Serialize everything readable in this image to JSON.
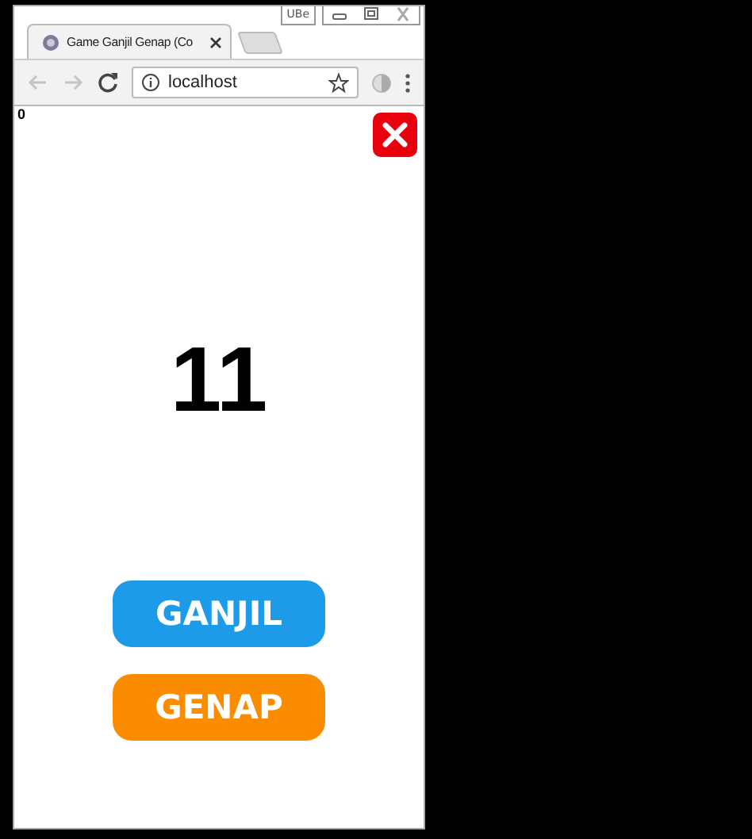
{
  "browser": {
    "extension_label": "UBe",
    "tab_title": "Game Ganjil Genap (Co",
    "url": "localhost"
  },
  "game": {
    "score": "0",
    "number": "11",
    "buttons": [
      {
        "label": "GANJIL",
        "color": "#1e9be8"
      },
      {
        "label": "GENAP",
        "color": "#fb8c00"
      }
    ]
  }
}
